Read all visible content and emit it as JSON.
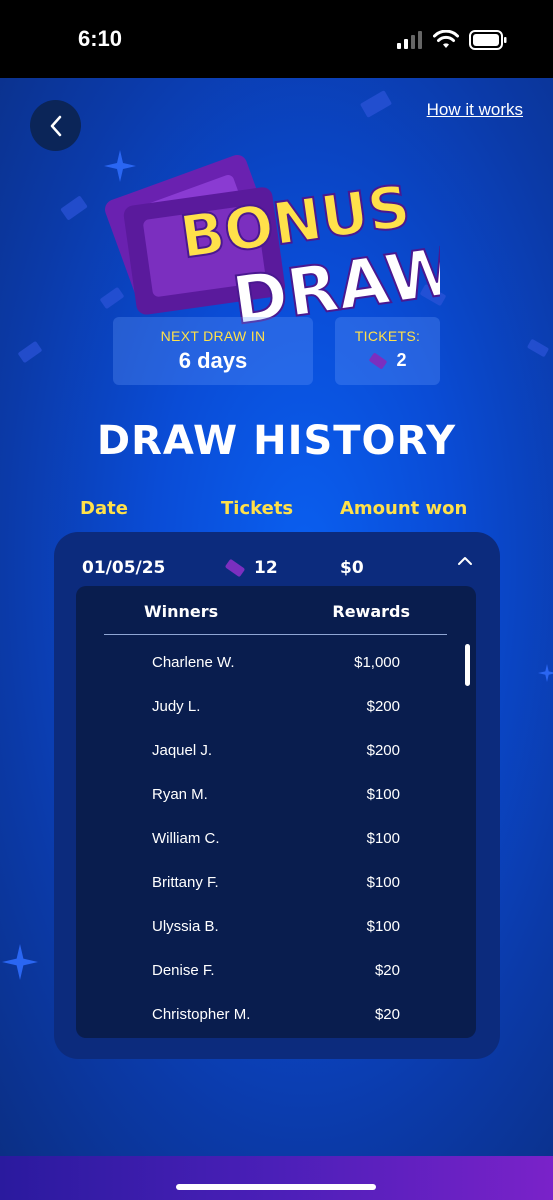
{
  "status_bar": {
    "time": "6:10"
  },
  "header": {
    "how_it_works": "How it works"
  },
  "logo": {
    "line1": "BONUS",
    "line2": "DRAW"
  },
  "next_draw": {
    "label": "NEXT DRAW IN",
    "value": "6 days"
  },
  "tickets": {
    "label": "TICKETS:",
    "count": "2"
  },
  "history": {
    "title": "DRAW HISTORY",
    "columns": {
      "date": "Date",
      "tickets": "Tickets",
      "amount": "Amount won"
    },
    "entry": {
      "date": "01/05/25",
      "tickets": "12",
      "amount": "$0",
      "winners_header": "Winners",
      "rewards_header": "Rewards",
      "winners": [
        {
          "name": "Charlene W.",
          "reward": "$1,000"
        },
        {
          "name": "Judy L.",
          "reward": "$200"
        },
        {
          "name": "Jaquel J.",
          "reward": "$200"
        },
        {
          "name": "Ryan M.",
          "reward": "$100"
        },
        {
          "name": "William C.",
          "reward": "$100"
        },
        {
          "name": "Brittany F.",
          "reward": "$100"
        },
        {
          "name": "Ulyssia B.",
          "reward": "$100"
        },
        {
          "name": "Denise F.",
          "reward": "$20"
        },
        {
          "name": "Christopher M.",
          "reward": "$20"
        }
      ]
    }
  },
  "colors": {
    "accent_yellow": "#ffe14a",
    "ticket_purple": "#7b2fbf",
    "card_bg": "#0c2b7d"
  }
}
